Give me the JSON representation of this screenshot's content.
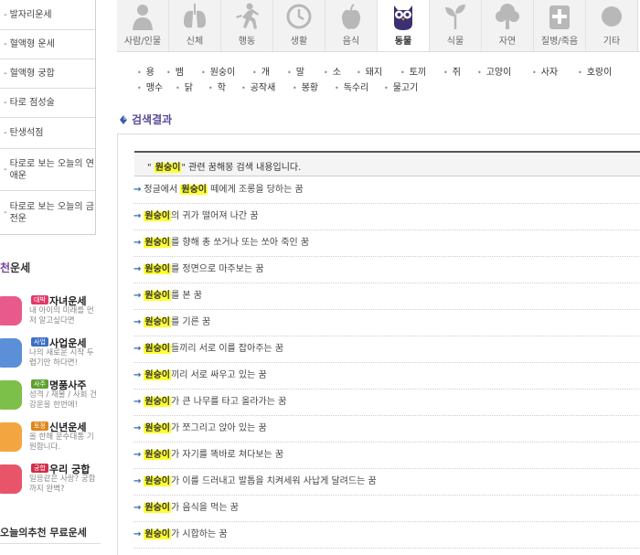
{
  "left_menu": {
    "items": [
      {
        "label": "발자리운세"
      },
      {
        "label": "혈액형 운세"
      },
      {
        "label": "혈액형 궁합"
      },
      {
        "label": "타로 점성술"
      },
      {
        "label": "탄생석점"
      },
      {
        "label": "타로로 보는 오늘의 연애운"
      },
      {
        "label": "타로로 보는 오늘의 금전운"
      }
    ]
  },
  "recommend": {
    "title_highlight": "천",
    "title_rest": "운세",
    "items": [
      {
        "badge": "대박",
        "name": "자녀운세",
        "desc": "내 아이의 미래를 먼저 알고싶다면",
        "color": "#e85a8c",
        "badge_color": "#e23a6a"
      },
      {
        "badge": "사업",
        "name": "사업운세",
        "desc": "나의 새로운 시작 두렵기만 하다면!",
        "color": "#5b8fd8",
        "badge_color": "#3d6fc2"
      },
      {
        "badge": "사주",
        "name": "명품사주",
        "desc": "성격 / 재물 / 사회 건강운을 한번에!",
        "color": "#7cc04a",
        "badge_color": "#5ea12e"
      },
      {
        "badge": "토정",
        "name": "신년운세",
        "desc": "올 한해 운수대통 기원합니다.",
        "color": "#f3a640",
        "badge_color": "#e0861c"
      },
      {
        "badge": "궁합",
        "name": "우리 궁합",
        "desc": "일응같은 사랑? 궁합까지 완벽?",
        "color": "#e8546a",
        "badge_color": "#d12f48"
      }
    ],
    "bottom_title": "오늘의추천 무료운세"
  },
  "categories": [
    {
      "label": "사람/인물",
      "icon": "person-icon",
      "active": false
    },
    {
      "label": "신체",
      "icon": "lungs-icon",
      "active": false
    },
    {
      "label": "행동",
      "icon": "running-icon",
      "active": false
    },
    {
      "label": "생활",
      "icon": "clock-icon",
      "active": false
    },
    {
      "label": "음식",
      "icon": "apple-icon",
      "active": false
    },
    {
      "label": "동물",
      "icon": "owl-icon",
      "active": true
    },
    {
      "label": "식물",
      "icon": "sprout-icon",
      "active": false
    },
    {
      "label": "자연",
      "icon": "tree-icon",
      "active": false
    },
    {
      "label": "질병/죽음",
      "icon": "medical-cross-icon",
      "active": false
    },
    {
      "label": "기타",
      "icon": "misc-icon",
      "active": false
    }
  ],
  "animals": {
    "row1": [
      "용",
      "뱀",
      "원숭이",
      "개",
      "말",
      "소",
      "돼지",
      "토끼",
      "쥐",
      "고양이",
      "사자",
      "호랑이"
    ],
    "row2": [
      "맹수",
      "닭",
      "학",
      "공작새",
      "봉황",
      "독수리",
      "물고기"
    ]
  },
  "results": {
    "title": "검색결과",
    "query_prefix": "\"",
    "query_keyword": "원숭이",
    "query_suffix": "\" 관련 꿈해몽 검색 내용입니다.",
    "keyword": "원숭이",
    "items": [
      {
        "pre": "정글에서 ",
        "post": " 떼에게 조롱을 당하는 꿈"
      },
      {
        "pre": "",
        "post": "의 귀가 떨어져 나간 꿈"
      },
      {
        "pre": "",
        "post": "를 향해 총 쏘거나 또는 쏘아 죽인 꿈"
      },
      {
        "pre": "",
        "post": "를 정면으로 마주보는 꿈"
      },
      {
        "pre": "",
        "post": "를 본 꿈"
      },
      {
        "pre": "",
        "post": "를 기른 꿈"
      },
      {
        "pre": "",
        "post": "들끼리 서로 이를 잡아주는 꿈"
      },
      {
        "pre": "",
        "post": "끼리 서로 싸우고 있는 꿈"
      },
      {
        "pre": "",
        "post": "가 큰 나무를 타고 올라가는 꿈"
      },
      {
        "pre": "",
        "post": "가 쪼그리고 앉아 있는 꿈"
      },
      {
        "pre": "",
        "post": "가 자기를 똑바로 쳐다보는 꿈"
      },
      {
        "pre": "",
        "post": "가 이를 드러내고 발톱을 치켜세워 사납게 달려드는 꿈"
      },
      {
        "pre": "",
        "post": "가 음식을 먹는 꿈"
      },
      {
        "pre": "",
        "post": "가 시합하는 꿈"
      }
    ]
  },
  "colors": {
    "accent": "#7a3fa1",
    "highlight": "#ffff33",
    "arrow": "#2e6db4"
  }
}
